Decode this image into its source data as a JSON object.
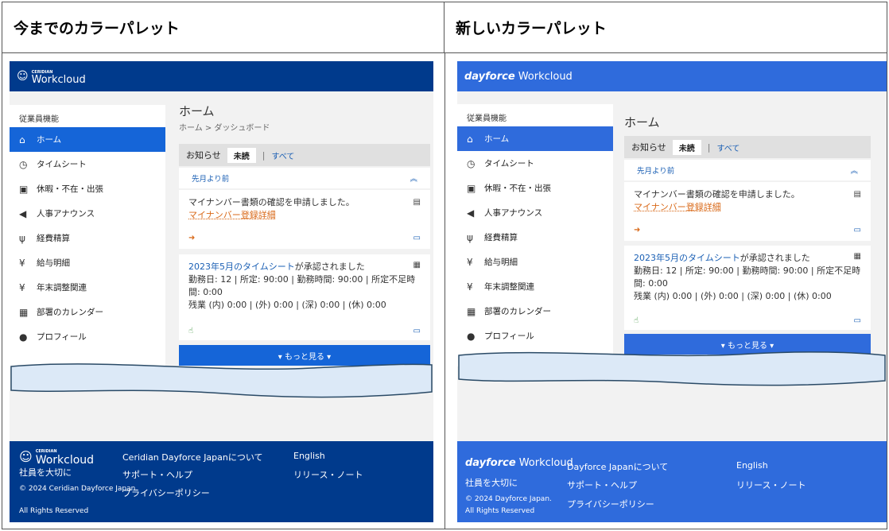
{
  "headers": {
    "old": "今までのカラーパレット",
    "new": "新しいカラーパレット"
  },
  "colors": {
    "old_brand": "#003a8c",
    "new_brand": "#2f6bdc",
    "active_old": "#1565d8",
    "active_new": "#2f6bdc",
    "link": "#1a5fb4",
    "orange": "#d96a1a"
  },
  "old": {
    "logo_small": "CERIDIAN",
    "logo": "Workcloud",
    "sidebar_title": "従業員機能",
    "items": [
      {
        "icon": "home-icon",
        "glyph": "⌂",
        "label": "ホーム"
      },
      {
        "icon": "clock-icon",
        "glyph": "◷",
        "label": "タイムシート"
      },
      {
        "icon": "suitcase-icon",
        "glyph": "▣",
        "label": "休暇・不在・出張"
      },
      {
        "icon": "megaphone-icon",
        "glyph": "◀",
        "label": "人事アナウンス"
      },
      {
        "icon": "cutlery-icon",
        "glyph": "ψ",
        "label": "経費精算"
      },
      {
        "icon": "yen-icon",
        "glyph": "¥",
        "label": "給与明細"
      },
      {
        "icon": "yen-icon",
        "glyph": "¥",
        "label": "年末調整関連"
      },
      {
        "icon": "calendar-icon",
        "glyph": "▦",
        "label": "部署のカレンダー"
      },
      {
        "icon": "user-icon",
        "glyph": "●",
        "label": "プロフィール"
      }
    ],
    "page_title": "ホーム",
    "breadcrumb": "ホーム > ダッシュボード",
    "tabs": {
      "label": "お知らせ",
      "unread": "未読",
      "sep": "|",
      "all": "すべて"
    },
    "section": "先月より前",
    "note1": "マイナンバー書類の確認を申請しました。",
    "note1_link": "マイナンバー登録詳細",
    "note2_link": "2023年5月のタイムシート",
    "note2_rest": "が承認されました",
    "note2_line1": "勤務日: 12 | 所定: 90:00 | 勤務時間: 90:00 | 所定不足時間: 0:00",
    "note2_line2": "残業 (内) 0:00 | (外) 0:00 | (深) 0:00 | (休) 0:00",
    "more": "▾ もっと見る ▾",
    "footer": {
      "logo_small": "CERIDIAN",
      "logo": "Workcloud",
      "tagline": "社員を大切に",
      "copyright": "© 2024 Ceridian Dayforce Japan.",
      "rights": "All Rights Reserved",
      "about": "Ceridian Dayforce Japanについて",
      "support": "サポート・ヘルプ",
      "privacy": "プライバシーポリシー",
      "english": "English",
      "release": "リリース・ノート"
    }
  },
  "new": {
    "logo_bold": "dayforce",
    "logo": "Workcloud",
    "sidebar_title": "従業員機能",
    "items": [
      {
        "icon": "home-icon",
        "glyph": "⌂",
        "label": "ホーム"
      },
      {
        "icon": "clock-icon",
        "glyph": "◷",
        "label": "タイムシート"
      },
      {
        "icon": "suitcase-icon",
        "glyph": "▣",
        "label": "休暇・不在・出張"
      },
      {
        "icon": "megaphone-icon",
        "glyph": "◀",
        "label": "人事アナウンス"
      },
      {
        "icon": "cutlery-icon",
        "glyph": "ψ",
        "label": "経費精算"
      },
      {
        "icon": "yen-icon",
        "glyph": "¥",
        "label": "給与明細"
      },
      {
        "icon": "yen-icon",
        "glyph": "¥",
        "label": "年末調整関連"
      },
      {
        "icon": "calendar-icon",
        "glyph": "▦",
        "label": "部署のカレンダー"
      },
      {
        "icon": "user-icon",
        "glyph": "●",
        "label": "プロフィール"
      }
    ],
    "page_title": "ホーム",
    "tabs": {
      "label": "お知らせ",
      "unread": "未読",
      "sep": "|",
      "all": "すべて"
    },
    "section": "先月より前",
    "note1": "マイナンバー書類の確認を申請しました。",
    "note1_link": "マイナンバー登録詳細",
    "note2_link": "2023年5月のタイムシート",
    "note2_rest": "が承認されました",
    "note2_line1": "勤務日: 12 | 所定: 90:00 | 勤務時間: 90:00 | 所定不足時間: 0:00",
    "note2_line2": "残業 (内) 0:00 | (外) 0:00 | (深) 0:00 | (休) 0:00",
    "more": "▾ もっと見る ▾",
    "footer": {
      "logo_bold": "dayforce",
      "logo": "Workcloud",
      "tagline": "社員を大切に",
      "copyright": "© 2024 Dayforce Japan.",
      "rights": "All Rights Reserved",
      "about": "Dayforce Japanについて",
      "support": "サポート・ヘルプ",
      "privacy": "プライバシーポリシー",
      "english": "English",
      "release": "リリース・ノート"
    }
  }
}
